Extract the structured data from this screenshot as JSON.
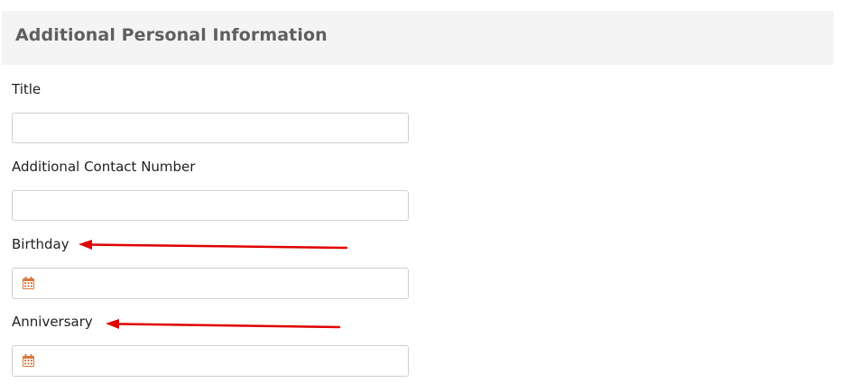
{
  "section": {
    "title": "Additional Personal Information"
  },
  "fields": {
    "title": {
      "label": "Title",
      "value": ""
    },
    "contact": {
      "label": "Additional Contact Number",
      "value": ""
    },
    "birthday": {
      "label": "Birthday",
      "value": "",
      "icon": "calendar-icon"
    },
    "anniversary": {
      "label": "Anniversary",
      "value": "",
      "icon": "calendar-icon"
    }
  },
  "colors": {
    "header_bg": "#f4f4f4",
    "header_text": "#5f5f5f",
    "calendar_icon": "#d9773a",
    "annotation_arrow": "#e00000",
    "input_border": "#cfcfcf"
  }
}
